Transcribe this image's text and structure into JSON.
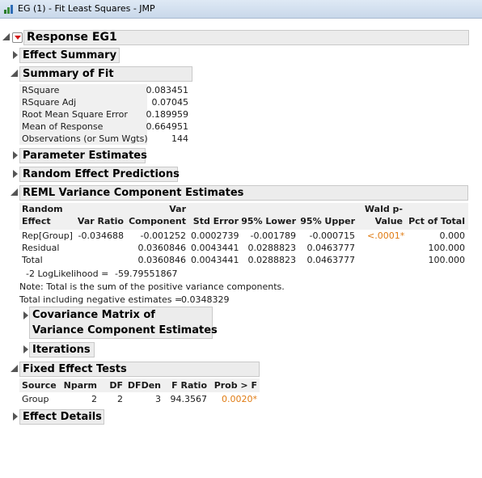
{
  "window": {
    "title": "EG (1) - Fit Least Squares - JMP"
  },
  "report": {
    "response_title": "Response EG1",
    "effect_summary": "Effect Summary",
    "summary_of_fit": {
      "title": "Summary of Fit",
      "rows": [
        {
          "label": "RSquare",
          "value": "0.083451"
        },
        {
          "label": "RSquare Adj",
          "value": "0.07045"
        },
        {
          "label": "Root Mean Square Error",
          "value": "0.189959"
        },
        {
          "label": "Mean of Response",
          "value": "0.664951"
        },
        {
          "label": "Observations (or Sum Wgts)",
          "value": "144"
        }
      ]
    },
    "parameter_estimates": "Parameter Estimates",
    "random_effect_predictions": "Random Effect Predictions",
    "reml": {
      "title": "REML Variance Component Estimates",
      "headers": {
        "random_effect_1": "Random",
        "random_effect_2": "Effect",
        "var_ratio": "Var Ratio",
        "var_component_1": "Var",
        "var_component_2": "Component",
        "std_error": "Std Error",
        "lower": "95% Lower",
        "upper": "95% Upper",
        "wald_1": "Wald p-",
        "wald_2": "Value",
        "pct_total": "Pct of Total"
      },
      "rows": [
        {
          "effect": "Rep[Group]",
          "var_ratio": "-0.034688",
          "var_component": "-0.001252",
          "std_error": "0.0002739",
          "lower": "-0.001789",
          "upper": "-0.000715",
          "wald": "<.0001*",
          "pct": "0.000"
        },
        {
          "effect": "Residual",
          "var_ratio": "",
          "var_component": "0.0360846",
          "std_error": "0.0043441",
          "lower": "0.0288823",
          "upper": "0.0463777",
          "wald": "",
          "pct": "100.000"
        },
        {
          "effect": "Total",
          "var_ratio": "",
          "var_component": "0.0360846",
          "std_error": "0.0043441",
          "lower": "0.0288823",
          "upper": "0.0463777",
          "wald": "",
          "pct": "100.000"
        }
      ],
      "loglik_label": "-2 LogLikelihood =",
      "loglik_value": "-59.79551867",
      "note": "Note: Total is the sum of the positive variance components.",
      "negative_label": "Total including negative estimates =",
      "negative_value": "0.0348329",
      "covariance_1": "Covariance Matrix of",
      "covariance_2": "Variance Component Estimates",
      "iterations": "Iterations"
    },
    "fixed_effect_tests": {
      "title": "Fixed Effect Tests",
      "headers": {
        "source": "Source",
        "nparm": "Nparm",
        "df": "DF",
        "dfden": "DFDen",
        "f_ratio": "F Ratio",
        "prob": "Prob > F"
      },
      "rows": [
        {
          "source": "Group",
          "nparm": "2",
          "df": "2",
          "dfden": "3",
          "f_ratio": "94.3567",
          "prob": "0.0020*"
        }
      ]
    },
    "effect_details": "Effect Details"
  },
  "colors": {
    "significant": "#e07b12",
    "header_bg": "#ececec",
    "disclosure_red": "#d31a1a"
  }
}
